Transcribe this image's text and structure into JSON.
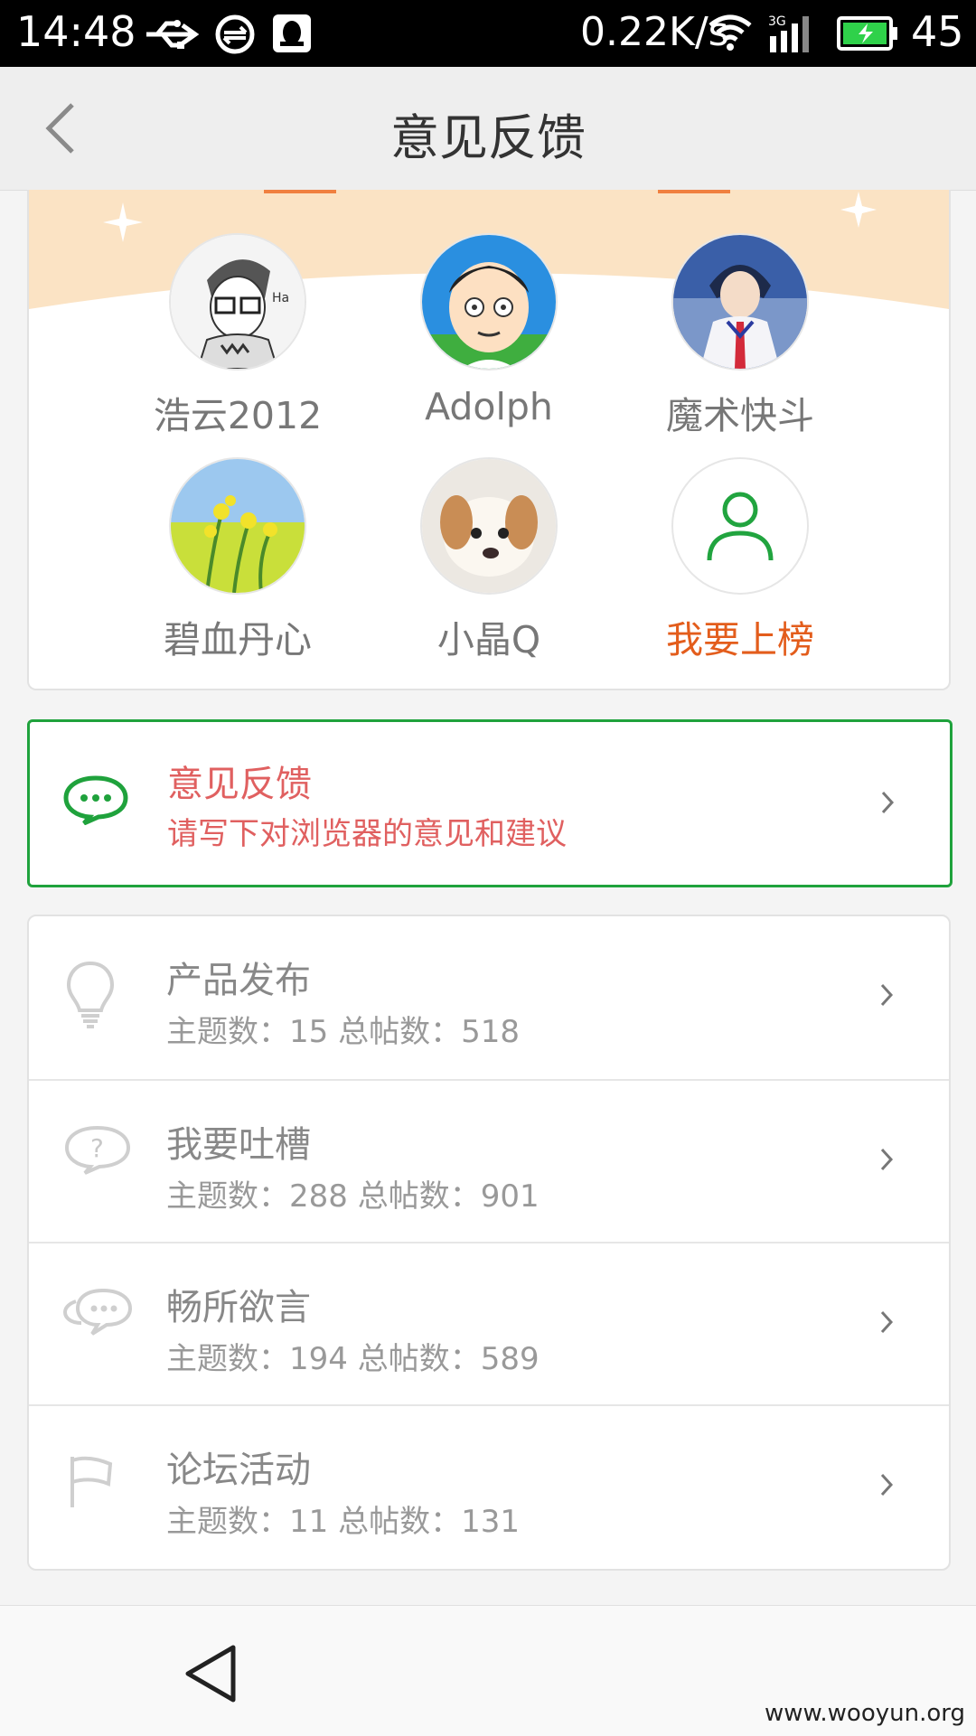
{
  "status_bar": {
    "time": "14:48",
    "net_speed": "0.22K/s",
    "battery_level": "45",
    "icons": [
      "usb-icon",
      "sync-icon",
      "qq-icon",
      "wifi-icon",
      "signal-3g-icon",
      "battery-icon"
    ]
  },
  "app_bar": {
    "title": "意见反馈",
    "back_icon": "chevron-left-icon"
  },
  "ranking": {
    "users": [
      {
        "name": "浩云2012",
        "avatar": "sketch-boy-avatar"
      },
      {
        "name": "Adolph",
        "avatar": "cartoon-man-avatar"
      },
      {
        "name": "魔术快斗",
        "avatar": "anime-detective-avatar"
      },
      {
        "name": "碧血丹心",
        "avatar": "flower-field-avatar"
      },
      {
        "name": "小晶Q",
        "avatar": "puppy-avatar"
      },
      {
        "name": "我要上榜",
        "avatar": "user-outline-icon",
        "highlight": true
      }
    ]
  },
  "feedback": {
    "title": "意见反馈",
    "subtitle": "请写下对浏览器的意见和建议",
    "icon": "chat-bubble-icon"
  },
  "forums": [
    {
      "title": "产品发布",
      "stats": "主题数：15  总帖数：518",
      "icon": "lightbulb-icon"
    },
    {
      "title": "我要吐槽",
      "stats": "主题数：288  总帖数：901",
      "icon": "question-bubble-icon"
    },
    {
      "title": "畅所欲言",
      "stats": "主题数：194  总帖数：589",
      "icon": "chat-bubbles-icon"
    },
    {
      "title": "论坛活动",
      "stats": "主题数：11  总帖数：131",
      "icon": "flag-icon"
    }
  ],
  "nav_bar": {
    "back_icon": "triangle-back-icon"
  },
  "watermark": "www.wooyun.org",
  "colors": {
    "accent_green": "#1fa23c",
    "feedback_text": "#e06060",
    "highlight_orange": "#e35d1c",
    "banner_peach": "#fbe3c4"
  }
}
